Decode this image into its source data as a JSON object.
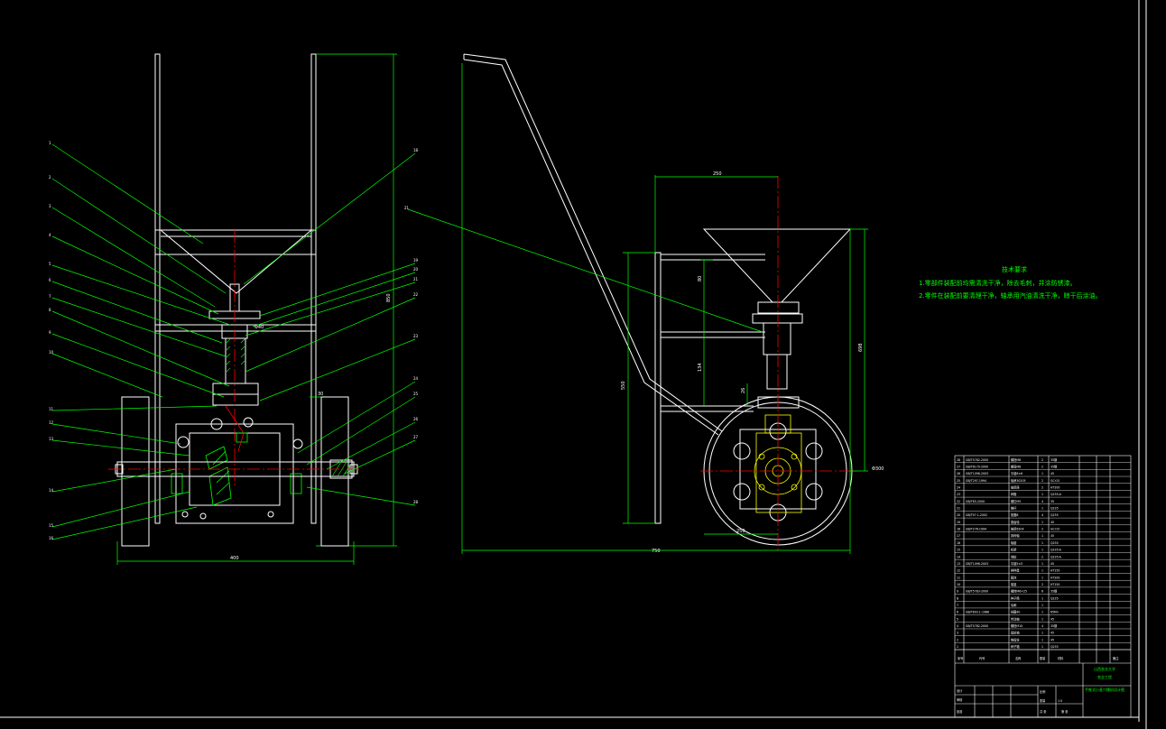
{
  "colors": {
    "background": "#000000",
    "outline": "#ffffff",
    "leader": "#00ff00",
    "centerline": "#ff0000",
    "hatch": "#00ff00",
    "hidden": "#ffff00",
    "dimension": "#00ff00"
  },
  "technical_notes": {
    "title": "技术要求",
    "line1": "1.零部件装配前均需清洗干净，除去毛刺，并涂防锈漆。",
    "line2": "2.零件在装配前要清理干净，轴承用汽油清洗干净，晾干后涂油。"
  },
  "front_view": {
    "overall_width_dim": "400",
    "side_height_dim": "850",
    "shaft_dim": "Φ40",
    "wheel_gap_dim": "30",
    "left_labels": [
      "1",
      "2",
      "3",
      "4",
      "5",
      "6",
      "7",
      "8",
      "9",
      "10",
      "11",
      "12",
      "13",
      "14",
      "15",
      "16",
      "17"
    ],
    "right_labels": [
      "18",
      "19",
      "20",
      "21",
      "22",
      "23",
      "24",
      "25",
      "26",
      "27",
      "28"
    ]
  },
  "side_view": {
    "overall_length_dim": "750",
    "hopper_width_dim": "250",
    "frame_height_dim": "550",
    "total_height_dim": "698",
    "hopper_height_dim": "80",
    "seed_tube_dim": "134",
    "small_dim": "26",
    "wheel_dia_dim": "Φ300",
    "wheel_offset_dim": "250",
    "handle_label": "21"
  },
  "parts_table": {
    "rows": [
      [
        "28",
        "GB/T5782-2000",
        "螺栓M8",
        "2",
        "35钢",
        ""
      ],
      [
        "27",
        "GB/T6170-2000",
        "螺母M8",
        "2",
        "35钢",
        ""
      ],
      [
        "26",
        "GB/T1096-2003",
        "平键6×6",
        "1",
        "45",
        ""
      ],
      [
        "25",
        "GB/T297-1994",
        "轴承30205",
        "2",
        "GCr15",
        ""
      ],
      [
        "24",
        "",
        "轴承座",
        "2",
        "HT200",
        ""
      ],
      [
        "23",
        "",
        "种箱",
        "1",
        "Q235-A",
        ""
      ],
      [
        "22",
        "GB/T65-2000",
        "螺钉M5",
        "4",
        "35",
        ""
      ],
      [
        "21",
        "",
        "推杆",
        "1",
        "Q235",
        ""
      ],
      [
        "20",
        "GB/T97.1-2002",
        "垫圈8",
        "4",
        "Q235",
        ""
      ],
      [
        "19",
        "",
        "锥齿轮",
        "1",
        "45",
        ""
      ],
      [
        "18",
        "GB/T276-1994",
        "轴承6204",
        "2",
        "GCr15",
        ""
      ],
      [
        "17",
        "",
        "排种轴",
        "1",
        "45",
        ""
      ],
      [
        "16",
        "",
        "轴套",
        "1",
        "Q235",
        ""
      ],
      [
        "15",
        "",
        "机架",
        "1",
        "Q235-A",
        ""
      ],
      [
        "14",
        "",
        "地轮",
        "2",
        "Q235-A",
        ""
      ],
      [
        "13",
        "GB/T1096-2003",
        "平键5×5",
        "1",
        "45",
        ""
      ],
      [
        "12",
        "",
        "排种盘",
        "1",
        "HT150",
        ""
      ],
      [
        "11",
        "",
        "箱体",
        "1",
        "HT200",
        ""
      ],
      [
        "10",
        "",
        "端盖",
        "2",
        "HT150",
        ""
      ],
      [
        "9",
        "GB/T5783-2000",
        "螺栓M6×25",
        "6",
        "35钢",
        ""
      ],
      [
        "8",
        "",
        "种子筒",
        "1",
        "Q235",
        ""
      ],
      [
        "7",
        "",
        "毛刷",
        "1",
        "",
        ""
      ],
      [
        "6",
        "GB/T893.1-1986",
        "挡圈40",
        "1",
        "65Mn",
        ""
      ],
      [
        "5",
        "",
        "传动轴",
        "1",
        "45",
        ""
      ],
      [
        "4",
        "GB/T5782-2000",
        "螺栓M10",
        "4",
        "35钢",
        ""
      ],
      [
        "3",
        "",
        "齿轮轴",
        "1",
        "45",
        ""
      ],
      [
        "2",
        "",
        "锥齿轮",
        "1",
        "45",
        ""
      ],
      [
        "1",
        "",
        "种子箱",
        "1",
        "Q235",
        ""
      ]
    ],
    "header": [
      "序号",
      "代号",
      "名称",
      "数量",
      "材料",
      "备注"
    ],
    "school": "山西农业大学",
    "school_sub": "农业工程",
    "drawing_title": "手推式小麦穴播机设计图",
    "scale_label": "比例",
    "scale_value": "1:5",
    "sheet_label": "共 张",
    "sheet_value": "第 张",
    "weight_label": "质量",
    "designer_label": "设计",
    "checker_label": "审核",
    "approver_label": "批准"
  }
}
